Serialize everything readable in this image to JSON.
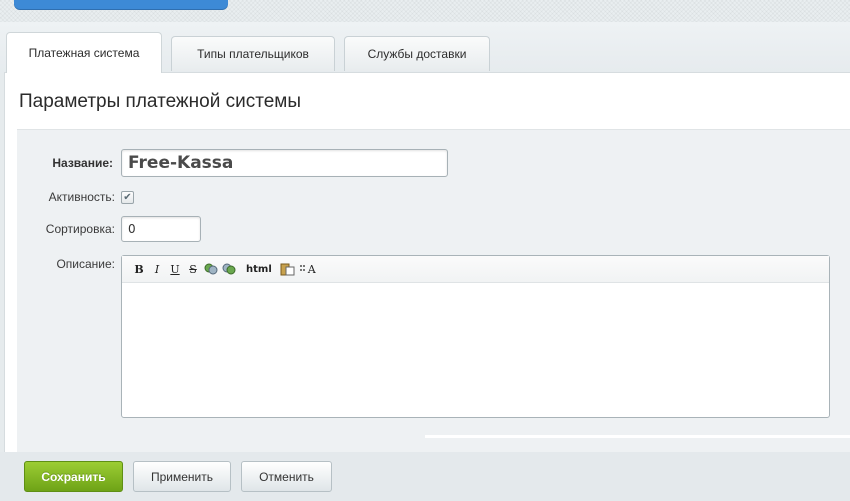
{
  "tabs": [
    {
      "label": "Платежная система",
      "active": true
    },
    {
      "label": "Типы плательщиков",
      "active": false
    },
    {
      "label": "Службы доставки",
      "active": false
    }
  ],
  "section": {
    "title": "Параметры платежной системы"
  },
  "form": {
    "name_label": "Название:",
    "name_value": "Free-Kassa",
    "active_label": "Активность:",
    "active_checked": true,
    "sort_label": "Сортировка:",
    "sort_value": "0",
    "description_label": "Описание:"
  },
  "editor_toolbar": {
    "bold": "B",
    "italic": "I",
    "underline": "U",
    "strike": "S",
    "html": "html",
    "font": "A"
  },
  "buttons": {
    "save": "Сохранить",
    "apply": "Применить",
    "cancel": "Отменить"
  },
  "colors": {
    "accent_blue": "#3d8ad6",
    "save_green": "#7fb522"
  }
}
